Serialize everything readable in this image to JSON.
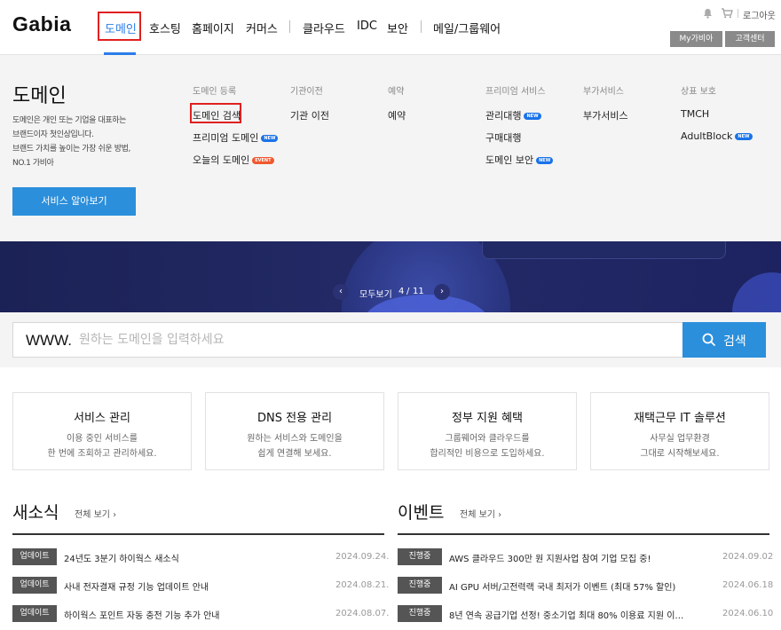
{
  "header": {
    "logo": "Gabia",
    "nav": [
      "도메인",
      "호스팅",
      "홈페이지",
      "커머스",
      "클라우드",
      "IDC",
      "보안",
      "메일/그룹웨어"
    ],
    "util": {
      "logout": "로그아웃",
      "my_gabia": "My가비아",
      "support": "고객센터"
    }
  },
  "mega_menu": {
    "title": "도메인",
    "description": "도메인은 개인 또는 기업을 대표하는\n브랜드이자 첫인상입니다.\n브랜드 가치를 높이는 가장 쉬운 방법,\nNO.1 가비아",
    "cta": "서비스 알아보기",
    "columns": [
      {
        "heading": "도메인 등록",
        "items": [
          {
            "label": "도메인 검색",
            "badge": ""
          },
          {
            "label": "프리미엄 도메인",
            "badge": "NEW"
          },
          {
            "label": "오늘의 도메인",
            "badge": "EVENT"
          }
        ]
      },
      {
        "heading": "기관이전",
        "items": [
          {
            "label": "기관 이전",
            "badge": ""
          }
        ]
      },
      {
        "heading": "예약",
        "items": [
          {
            "label": "예약",
            "badge": ""
          }
        ]
      },
      {
        "heading": "프리미엄 서비스",
        "items": [
          {
            "label": "관리대행",
            "badge": "NEW"
          },
          {
            "label": "구매대행",
            "badge": ""
          },
          {
            "label": "도메인 보안",
            "badge": "NEW"
          }
        ]
      },
      {
        "heading": "부가서비스",
        "items": [
          {
            "label": "부가서비스",
            "badge": ""
          }
        ]
      },
      {
        "heading": "상표 보호",
        "items": [
          {
            "label": "TMCH",
            "badge": ""
          },
          {
            "label": "AdultBlock",
            "badge": "NEW"
          }
        ]
      }
    ]
  },
  "banner": {
    "pager_label": "모두보기",
    "current": "4",
    "total": "11",
    "prev_icon": "chevron-left-icon",
    "next_icon": "chevron-right-icon"
  },
  "search": {
    "prefix": "WWW.",
    "placeholder": "원하는 도메인을 입력하세요",
    "value": "",
    "button": "검색"
  },
  "cards": [
    {
      "title": "서비스 관리",
      "desc": "이용 중인 서비스를\n한 번에 조회하고 관리하세요."
    },
    {
      "title": "DNS 전용 관리",
      "desc": "원하는 서비스와 도메인을\n쉽게 연결해 보세요."
    },
    {
      "title": "정부 지원 혜택",
      "desc": "그룹웨어와 클라우드를\n합리적인 비용으로 도입하세요."
    },
    {
      "title": "재택근무 IT 솔루션",
      "desc": "사무실 업무환경\n그대로 시작해보세요."
    }
  ],
  "news": {
    "title": "새소식",
    "more": "전체 보기",
    "items": [
      {
        "tag": "업데이트",
        "text": "24년도 3분기 하이웍스 새소식",
        "date": "2024.09.24."
      },
      {
        "tag": "업데이트",
        "text": "사내 전자결재 규정 기능 업데이트 안내",
        "date": "2024.08.21."
      },
      {
        "tag": "업데이트",
        "text": "하이웍스 포인트 자동 충전 기능 추가 안내",
        "date": "2024.08.07."
      }
    ]
  },
  "events": {
    "title": "이벤트",
    "more": "전체 보기",
    "items": [
      {
        "tag": "진행중",
        "text": "AWS 클라우드 300만 원 지원사업 참여 기업 모집 중!",
        "date": "2024.09.02"
      },
      {
        "tag": "진행중",
        "text": "AI GPU 서버/고전력랙 국내 최저가 이벤트 (최대 57% 할인)",
        "date": "2024.06.18"
      },
      {
        "tag": "진행중",
        "text": "8년 연속 공급기업 선정! 중소기업 최대 80% 이용료 지원 이…",
        "date": "2024.06.10"
      }
    ]
  },
  "colors": {
    "accent": "#2b8fdb",
    "highlight": "#e02020",
    "banner": "#1b2255"
  }
}
